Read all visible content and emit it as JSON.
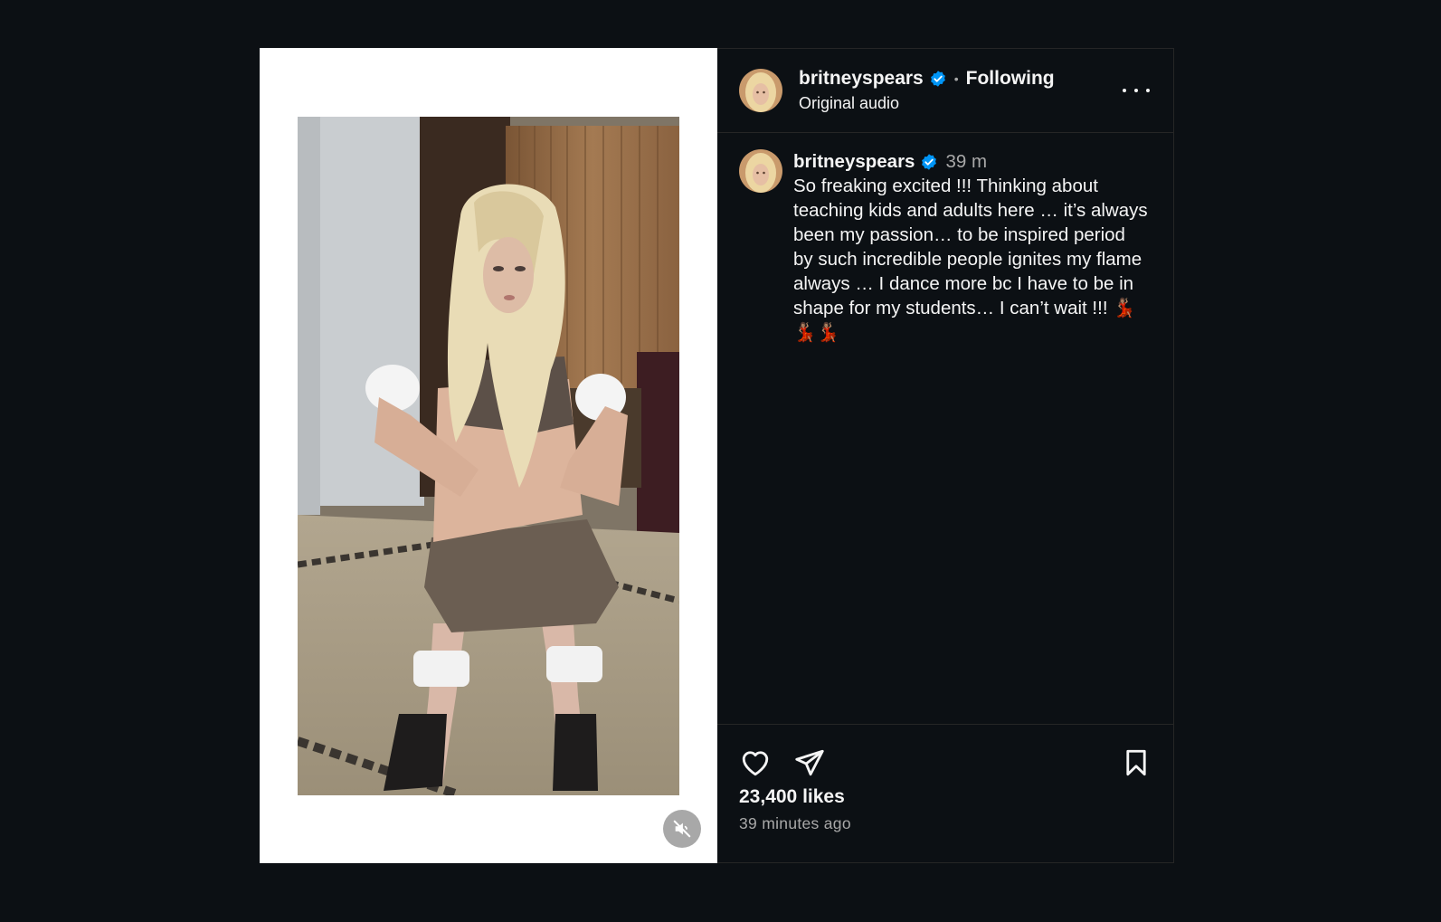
{
  "post": {
    "username": "britneyspears",
    "following_label": "Following",
    "separator": "•",
    "audio_label": "Original audio",
    "caption_time": "39 m",
    "caption": "So freaking excited !!! Thinking about teaching kids and adults here … it’s always been my passion… to be inspired period by such incredible people ignites my flame always … I dance more bc I have to be in shape for my students… I can’t wait !!! 💃🏽💃🏽💃🏽",
    "likes": "23,400 likes",
    "timestamp": "39 minutes ago"
  },
  "icons": {
    "verified": "verified-badge-icon",
    "more": "more-options-icon",
    "like": "heart-icon",
    "share": "share-icon",
    "save": "bookmark-icon",
    "mute": "muted-speaker-icon"
  },
  "colors": {
    "background": "#0c1014",
    "panel_border": "#262626",
    "verified": "#0095f6",
    "secondary_text": "#a8a8a8",
    "media_matte": "#ffffff"
  }
}
